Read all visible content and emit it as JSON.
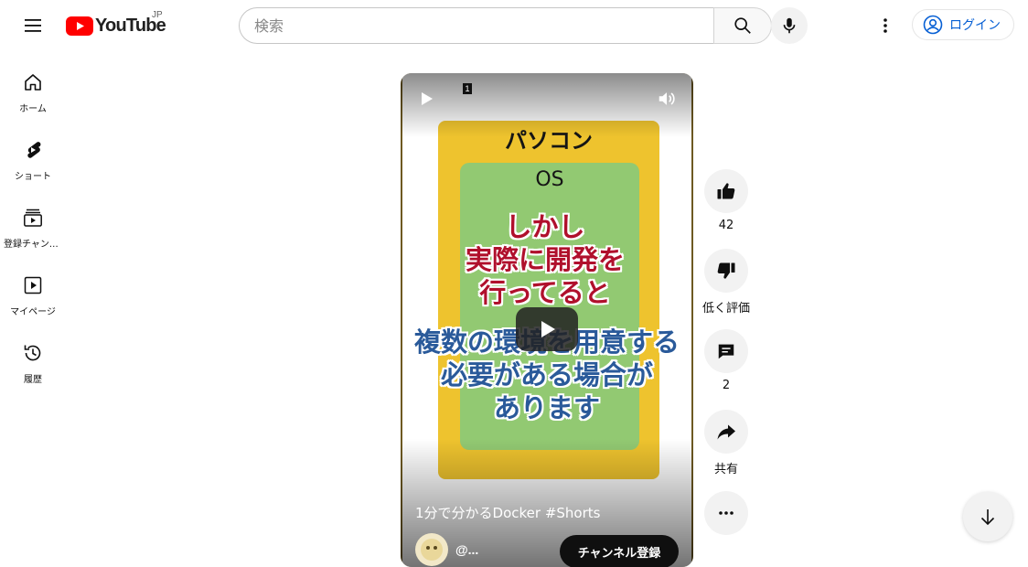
{
  "header": {
    "logo_text": "YouTube",
    "region": "JP",
    "search": {
      "placeholder": "検索"
    },
    "signin_label": "ログイン"
  },
  "sidebar": {
    "items": [
      {
        "label": "ホーム",
        "icon": "home-icon"
      },
      {
        "label": "ショート",
        "icon": "shorts-icon"
      },
      {
        "label": "登録チャンネル",
        "icon": "subscriptions-icon"
      },
      {
        "label": "マイページ",
        "icon": "you-icon"
      },
      {
        "label": "履歴",
        "icon": "history-icon"
      }
    ]
  },
  "video": {
    "counter": "1",
    "slide_title": "パソコン",
    "slide_os": "OS",
    "caption_red": [
      "しかし",
      "実際に開発を",
      "行ってると"
    ],
    "caption_blue": [
      "複数の環境を用意する",
      "必要がある場合が",
      "あります"
    ],
    "title": "1分で分かるDocker #Shorts",
    "channel_name": "@...",
    "subscribe_label": "チャンネル登録"
  },
  "actions": {
    "like_count": "42",
    "dislike_label": "低く評価",
    "comment_count": "2",
    "share_label": "共有"
  },
  "colors": {
    "brand_red": "#ff0000",
    "link_blue": "#065fd4",
    "slide_yellow": "#eec32e",
    "slide_green": "#92c972",
    "caption_red": "#b0102c",
    "caption_blue": "#2a5a9a"
  }
}
